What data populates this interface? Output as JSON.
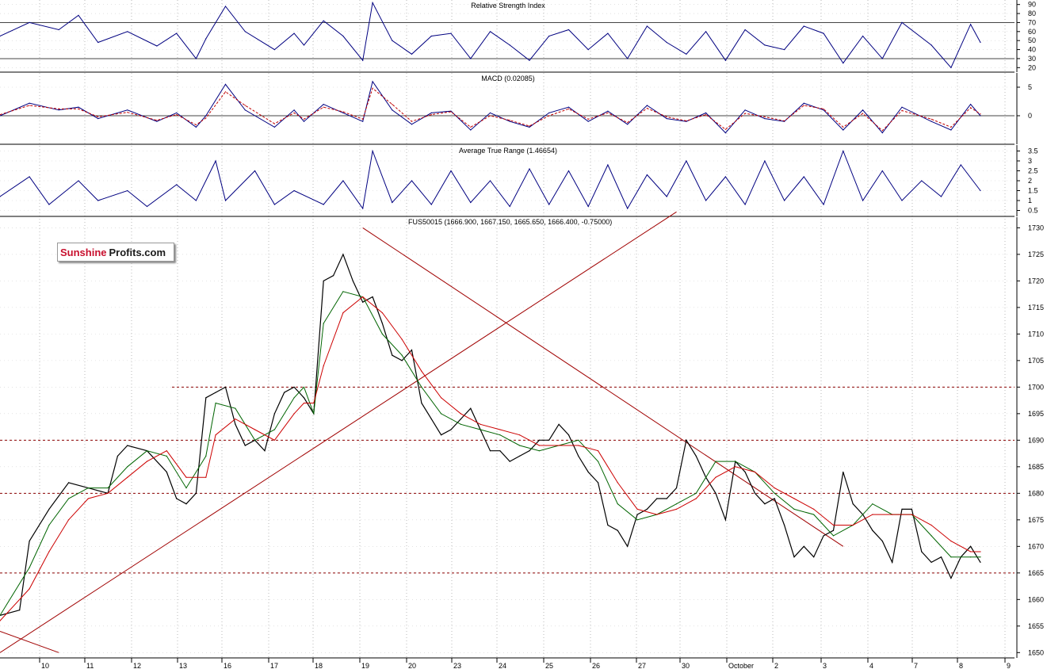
{
  "chart_data": [
    {
      "type": "line",
      "title": "Relative Strength Index",
      "yticks": [
        20,
        30,
        40,
        50,
        60,
        70,
        80,
        90
      ],
      "ylim": [
        15,
        95
      ],
      "reference_lines": [
        30,
        70
      ],
      "series": [
        {
          "color": "#000080",
          "x": [
            0,
            0.03,
            0.06,
            0.08,
            0.1,
            0.13,
            0.16,
            0.18,
            0.2,
            0.21,
            0.23,
            0.25,
            0.28,
            0.3,
            0.31,
            0.33,
            0.35,
            0.37,
            0.38,
            0.4,
            0.42,
            0.44,
            0.46,
            0.48,
            0.5,
            0.52,
            0.54,
            0.56,
            0.58,
            0.6,
            0.62,
            0.64,
            0.66,
            0.68,
            0.7,
            0.72,
            0.74,
            0.76,
            0.78,
            0.8,
            0.82,
            0.84,
            0.86,
            0.88,
            0.9,
            0.92,
            0.95,
            0.97,
            0.99,
            1.0
          ],
          "values": [
            55,
            70,
            62,
            78,
            48,
            60,
            44,
            58,
            30,
            52,
            88,
            60,
            40,
            58,
            45,
            72,
            55,
            28,
            92,
            50,
            35,
            55,
            58,
            30,
            60,
            45,
            28,
            55,
            62,
            40,
            58,
            30,
            66,
            48,
            35,
            60,
            28,
            62,
            45,
            40,
            66,
            58,
            25,
            55,
            30,
            70,
            45,
            20,
            68,
            48
          ]
        }
      ]
    },
    {
      "type": "line",
      "title": "MACD (0.02085)",
      "yticks": [
        5,
        0
      ],
      "ylim": [
        -5,
        7.5
      ],
      "reference_lines": [
        0
      ],
      "series": [
        {
          "name": "MACD",
          "color": "#000080",
          "x": [
            0,
            0.03,
            0.06,
            0.08,
            0.1,
            0.13,
            0.16,
            0.18,
            0.2,
            0.21,
            0.23,
            0.25,
            0.28,
            0.3,
            0.31,
            0.33,
            0.35,
            0.37,
            0.38,
            0.4,
            0.42,
            0.44,
            0.46,
            0.48,
            0.5,
            0.52,
            0.54,
            0.56,
            0.58,
            0.6,
            0.62,
            0.64,
            0.66,
            0.68,
            0.7,
            0.72,
            0.74,
            0.76,
            0.78,
            0.8,
            0.82,
            0.84,
            0.86,
            0.88,
            0.9,
            0.92,
            0.95,
            0.97,
            0.99,
            1.0
          ],
          "values": [
            0,
            2.2,
            1.0,
            1.5,
            -0.5,
            1.0,
            -1.0,
            0.5,
            -2.0,
            0,
            5.5,
            1.0,
            -2.0,
            1.0,
            -1.0,
            2.0,
            0.5,
            -1.0,
            6.0,
            1.0,
            -1.5,
            0.5,
            0.8,
            -2.5,
            0.5,
            -1.0,
            -2.0,
            0.5,
            1.5,
            -1.0,
            0.8,
            -1.5,
            1.8,
            -0.5,
            -1.0,
            0.5,
            -3.0,
            1.0,
            -0.5,
            -1.0,
            2.2,
            1.0,
            -2.5,
            1.0,
            -3.0,
            1.5,
            -1.0,
            -2.5,
            2.0,
            0
          ]
        },
        {
          "name": "Signal",
          "color": "#c00000",
          "x": [
            0,
            0.03,
            0.06,
            0.08,
            0.1,
            0.13,
            0.16,
            0.18,
            0.2,
            0.21,
            0.23,
            0.25,
            0.28,
            0.3,
            0.31,
            0.33,
            0.35,
            0.37,
            0.38,
            0.4,
            0.42,
            0.44,
            0.46,
            0.48,
            0.5,
            0.52,
            0.54,
            0.56,
            0.58,
            0.6,
            0.62,
            0.64,
            0.66,
            0.68,
            0.7,
            0.72,
            0.74,
            0.76,
            0.78,
            0.8,
            0.82,
            0.84,
            0.86,
            0.88,
            0.9,
            0.92,
            0.95,
            0.97,
            0.99,
            1.0
          ],
          "values": [
            0.2,
            1.8,
            1.2,
            1.2,
            -0.2,
            0.6,
            -0.8,
            0.2,
            -1.6,
            -0.4,
            4.2,
            1.8,
            -1.4,
            0.5,
            -0.6,
            1.5,
            0.7,
            -0.6,
            4.8,
            2.0,
            -1.0,
            0.2,
            0.7,
            -2.0,
            0,
            -0.8,
            -1.8,
            0,
            1.2,
            -0.6,
            0.5,
            -1.2,
            1.3,
            -0.2,
            -0.9,
            0.2,
            -2.4,
            0.4,
            -0.2,
            -0.9,
            1.8,
            1.2,
            -2.0,
            0.4,
            -2.6,
            0.9,
            -0.6,
            -2.0,
            1.4,
            0.3
          ]
        }
      ]
    },
    {
      "type": "line",
      "title": "Average True Range (1.46654)",
      "yticks": [
        0.5,
        1.0,
        1.5,
        2.0,
        2.5,
        3.0,
        3.5
      ],
      "ylim": [
        0.2,
        3.8
      ],
      "series": [
        {
          "color": "#000080",
          "x": [
            0,
            0.03,
            0.05,
            0.08,
            0.1,
            0.13,
            0.15,
            0.18,
            0.2,
            0.22,
            0.23,
            0.26,
            0.28,
            0.3,
            0.33,
            0.35,
            0.37,
            0.38,
            0.4,
            0.42,
            0.44,
            0.46,
            0.48,
            0.5,
            0.52,
            0.54,
            0.56,
            0.58,
            0.6,
            0.62,
            0.64,
            0.66,
            0.68,
            0.7,
            0.72,
            0.74,
            0.76,
            0.78,
            0.8,
            0.82,
            0.84,
            0.86,
            0.88,
            0.9,
            0.92,
            0.94,
            0.96,
            0.98,
            1.0
          ],
          "values": [
            1.2,
            2.2,
            0.8,
            2.0,
            1.0,
            1.5,
            0.7,
            1.8,
            1.0,
            3.0,
            1.0,
            2.5,
            0.8,
            1.5,
            0.8,
            2.0,
            0.6,
            3.5,
            0.9,
            2.0,
            0.8,
            2.5,
            0.9,
            2.0,
            0.7,
            2.6,
            0.8,
            2.5,
            0.7,
            2.8,
            0.6,
            2.3,
            1.2,
            3.0,
            1.0,
            2.2,
            0.8,
            3.0,
            1.0,
            2.2,
            0.8,
            3.5,
            1.0,
            2.5,
            1.0,
            2.0,
            1.2,
            2.8,
            1.5
          ]
        }
      ]
    },
    {
      "type": "line",
      "title": "FUS50015 (1666.900, 1667.150, 1665.650, 1666.400, -0.75000)",
      "yticks": [
        1650,
        1655,
        1660,
        1665,
        1670,
        1675,
        1680,
        1685,
        1690,
        1695,
        1700,
        1705,
        1710,
        1715,
        1720,
        1725,
        1730
      ],
      "ylim": [
        1649,
        1732
      ],
      "xtick_labels": [
        "10",
        "11",
        "12",
        "13",
        "16",
        "17",
        "18",
        "19",
        "20",
        "23",
        "24",
        "25",
        "26",
        "27",
        "30",
        "October",
        "2",
        "3",
        "4",
        "7",
        "8",
        "9"
      ],
      "reference_lines": [
        1665,
        1680,
        1690,
        1700
      ],
      "trendlines": [
        {
          "color": "#a00000",
          "from": [
            0,
            1650
          ],
          "to": [
            0.69,
            1733
          ]
        },
        {
          "color": "#a00000",
          "from": [
            0.37,
            1730
          ],
          "to": [
            0.86,
            1670
          ]
        },
        {
          "color": "#a00000",
          "from": [
            0,
            1654
          ],
          "to": [
            0.06,
            1650
          ]
        }
      ],
      "series": [
        {
          "name": "Price",
          "color": "#000000",
          "x": [
            0,
            0.02,
            0.03,
            0.05,
            0.07,
            0.09,
            0.11,
            0.12,
            0.13,
            0.15,
            0.17,
            0.18,
            0.19,
            0.2,
            0.21,
            0.22,
            0.23,
            0.24,
            0.25,
            0.26,
            0.27,
            0.28,
            0.29,
            0.3,
            0.31,
            0.32,
            0.33,
            0.34,
            0.35,
            0.36,
            0.365,
            0.37,
            0.38,
            0.39,
            0.4,
            0.41,
            0.42,
            0.43,
            0.44,
            0.45,
            0.46,
            0.47,
            0.48,
            0.49,
            0.5,
            0.51,
            0.52,
            0.53,
            0.54,
            0.55,
            0.56,
            0.57,
            0.58,
            0.59,
            0.6,
            0.61,
            0.62,
            0.63,
            0.64,
            0.65,
            0.66,
            0.67,
            0.68,
            0.69,
            0.7,
            0.71,
            0.72,
            0.73,
            0.74,
            0.75,
            0.76,
            0.77,
            0.78,
            0.79,
            0.8,
            0.81,
            0.82,
            0.83,
            0.84,
            0.85,
            0.86,
            0.87,
            0.88,
            0.89,
            0.9,
            0.91,
            0.92,
            0.93,
            0.94,
            0.95,
            0.96,
            0.97,
            0.98,
            0.99,
            1.0
          ],
          "values": [
            1657,
            1658,
            1671,
            1677,
            1682,
            1681,
            1680,
            1687,
            1689,
            1688,
            1684,
            1679,
            1678,
            1680,
            1698,
            1699,
            1700,
            1693,
            1689,
            1690,
            1688,
            1695,
            1699,
            1700,
            1698,
            1695,
            1720,
            1721,
            1725,
            1720,
            1718,
            1716,
            1717,
            1712,
            1706,
            1705,
            1707,
            1697,
            1694,
            1691,
            1692,
            1694,
            1696,
            1692,
            1688,
            1688,
            1686,
            1687,
            1688,
            1690,
            1690,
            1693,
            1691,
            1687,
            1684,
            1682,
            1674,
            1673,
            1670,
            1676,
            1677,
            1679,
            1679,
            1681,
            1690,
            1687,
            1683,
            1680,
            1675,
            1686,
            1684,
            1680,
            1678,
            1679,
            1674,
            1668,
            1670,
            1668,
            1672,
            1673,
            1684,
            1678,
            1676,
            1673,
            1671,
            1667,
            1677,
            1677,
            1669,
            1667,
            1668,
            1664,
            1668,
            1670,
            1667
          ]
        },
        {
          "name": "MA short",
          "color": "#006400",
          "x": [
            0,
            0.03,
            0.05,
            0.07,
            0.09,
            0.11,
            0.13,
            0.15,
            0.17,
            0.19,
            0.21,
            0.22,
            0.24,
            0.26,
            0.28,
            0.3,
            0.31,
            0.32,
            0.33,
            0.35,
            0.37,
            0.39,
            0.41,
            0.43,
            0.45,
            0.47,
            0.49,
            0.51,
            0.53,
            0.55,
            0.57,
            0.59,
            0.61,
            0.63,
            0.65,
            0.67,
            0.69,
            0.71,
            0.73,
            0.75,
            0.77,
            0.79,
            0.81,
            0.83,
            0.85,
            0.87,
            0.89,
            0.91,
            0.93,
            0.95,
            0.97,
            0.99,
            1.0
          ],
          "values": [
            1657,
            1666,
            1674,
            1679,
            1681,
            1681,
            1685,
            1688,
            1687,
            1681,
            1687,
            1697,
            1696,
            1690,
            1692,
            1698,
            1700,
            1695,
            1712,
            1718,
            1717,
            1710,
            1706,
            1700,
            1695,
            1693,
            1692,
            1691,
            1689,
            1688,
            1689,
            1690,
            1686,
            1678,
            1675,
            1676,
            1678,
            1680,
            1686,
            1686,
            1684,
            1680,
            1677,
            1676,
            1672,
            1674,
            1678,
            1676,
            1676,
            1672,
            1668,
            1668,
            1668
          ]
        },
        {
          "name": "MA long",
          "color": "#cc0000",
          "x": [
            0,
            0.03,
            0.05,
            0.07,
            0.09,
            0.11,
            0.13,
            0.15,
            0.17,
            0.19,
            0.21,
            0.22,
            0.24,
            0.26,
            0.28,
            0.3,
            0.31,
            0.32,
            0.33,
            0.35,
            0.37,
            0.39,
            0.41,
            0.43,
            0.45,
            0.47,
            0.49,
            0.51,
            0.53,
            0.55,
            0.57,
            0.59,
            0.61,
            0.63,
            0.65,
            0.67,
            0.69,
            0.71,
            0.73,
            0.75,
            0.77,
            0.79,
            0.81,
            0.83,
            0.85,
            0.87,
            0.89,
            0.91,
            0.93,
            0.95,
            0.97,
            0.99,
            1.0
          ],
          "values": [
            1656,
            1662,
            1669,
            1675,
            1679,
            1680,
            1683,
            1686,
            1688,
            1683,
            1683,
            1691,
            1694,
            1692,
            1690,
            1695,
            1697,
            1697,
            1704,
            1714,
            1717,
            1714,
            1709,
            1703,
            1698,
            1695,
            1693,
            1692,
            1691,
            1689,
            1689,
            1689,
            1688,
            1682,
            1677,
            1676,
            1677,
            1679,
            1683,
            1685,
            1684,
            1681,
            1679,
            1677,
            1674,
            1674,
            1676,
            1676,
            1676,
            1674,
            1671,
            1669,
            1669
          ]
        }
      ]
    }
  ],
  "brand": {
    "part1": "Sunshine",
    "part2": "Profits.com",
    "color1": "#c8102e",
    "color2": "#1a1a1a"
  }
}
